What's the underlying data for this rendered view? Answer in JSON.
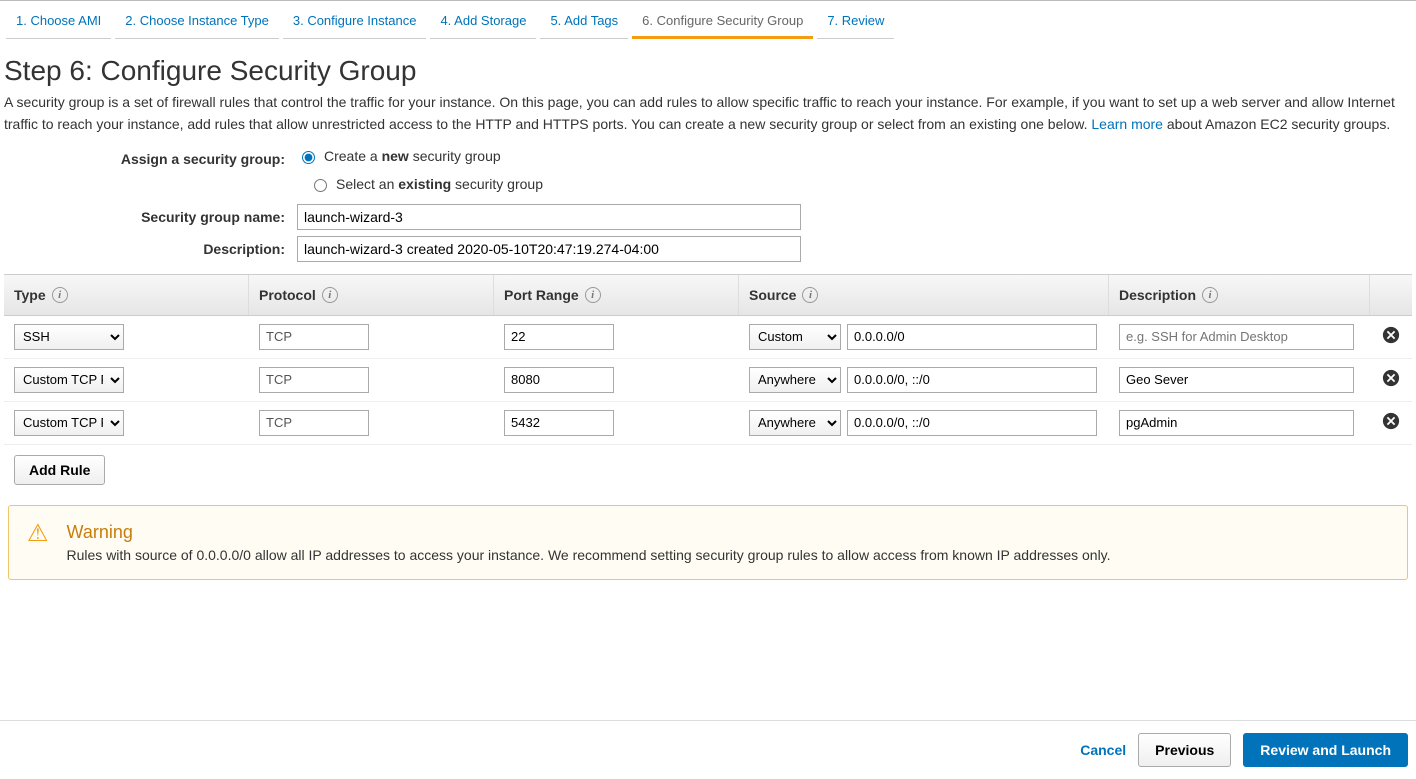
{
  "nav": {
    "items": [
      {
        "label": "1. Choose AMI",
        "active": false
      },
      {
        "label": "2. Choose Instance Type",
        "active": false
      },
      {
        "label": "3. Configure Instance",
        "active": false
      },
      {
        "label": "4. Add Storage",
        "active": false
      },
      {
        "label": "5. Add Tags",
        "active": false
      },
      {
        "label": "6. Configure Security Group",
        "active": true
      },
      {
        "label": "7. Review",
        "active": false
      }
    ]
  },
  "page": {
    "heading": "Step 6: Configure Security Group",
    "intro_prefix": "A security group is a set of firewall rules that control the traffic for your instance. On this page, you can add rules to allow specific traffic to reach your instance. For example, if you want to set up a web server and allow Internet traffic to reach your instance, add rules that allow unrestricted access to the HTTP and HTTPS ports. You can create a new security group or select from an existing one below. ",
    "intro_link": "Learn more",
    "intro_suffix": " about Amazon EC2 security groups."
  },
  "form": {
    "assign_label": "Assign a security group:",
    "radio_create_prefix": "Create a ",
    "radio_create_bold": "new",
    "radio_create_suffix": " security group",
    "radio_select_prefix": "Select an ",
    "radio_select_bold": "existing",
    "radio_select_suffix": " security group",
    "name_label": "Security group name:",
    "name_value": "launch-wizard-3",
    "desc_label": "Description:",
    "desc_value": "launch-wizard-3 created 2020-05-10T20:47:19.274-04:00"
  },
  "table": {
    "headers": {
      "type": "Type",
      "protocol": "Protocol",
      "port": "Port Range",
      "source": "Source",
      "description": "Description"
    },
    "rows": [
      {
        "type": "SSH",
        "protocol": "TCP",
        "port": "22",
        "source_mode": "Custom",
        "source_ip": "0.0.0.0/0",
        "description": "",
        "description_placeholder": "e.g. SSH for Admin Desktop"
      },
      {
        "type": "Custom TCP Rule",
        "protocol": "TCP",
        "port": "8080",
        "source_mode": "Anywhere",
        "source_ip": "0.0.0.0/0, ::/0",
        "description": "Geo Sever",
        "description_placeholder": ""
      },
      {
        "type": "Custom TCP Rule",
        "protocol": "TCP",
        "port": "5432",
        "source_mode": "Anywhere",
        "source_ip": "0.0.0.0/0, ::/0",
        "description": "pgAdmin",
        "description_placeholder": ""
      }
    ],
    "add_rule": "Add Rule"
  },
  "warning": {
    "title": "Warning",
    "text": "Rules with source of 0.0.0.0/0 allow all IP addresses to access your instance. We recommend setting security group rules to allow access from known IP addresses only."
  },
  "footer": {
    "cancel": "Cancel",
    "previous": "Previous",
    "launch": "Review and Launch"
  }
}
